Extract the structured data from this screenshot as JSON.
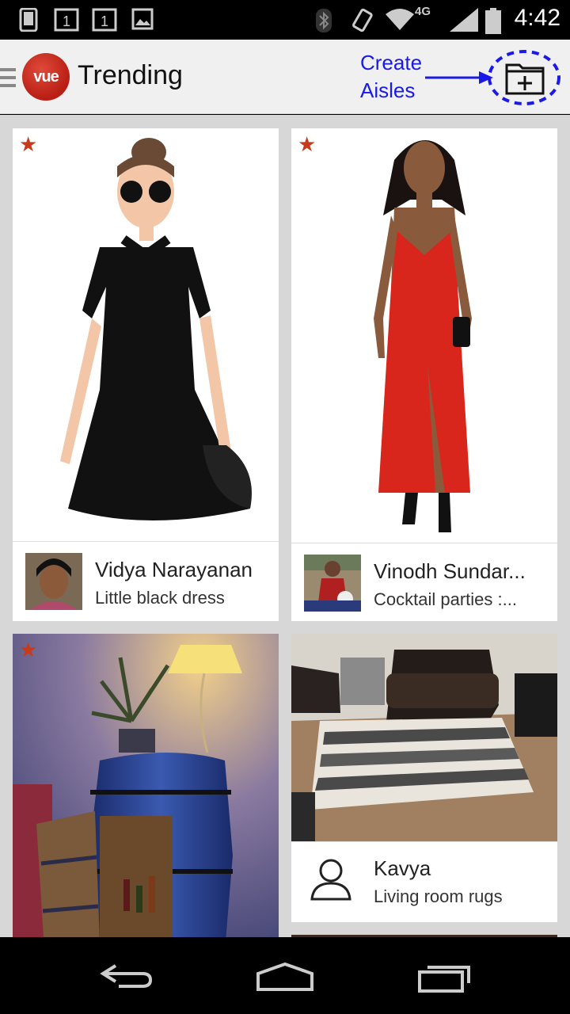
{
  "status_bar": {
    "time": "4:42",
    "network": "4G",
    "icons": [
      "phone-icon",
      "sim1-icon",
      "sim1-icon",
      "image-icon",
      "bluetooth-icon",
      "vibrate-icon",
      "wifi-icon",
      "signal-icon",
      "battery-icon"
    ]
  },
  "action_bar": {
    "logo_text": "vue",
    "title": "Trending",
    "annotation_line1": "Create",
    "annotation_line2": "Aisles",
    "add_icon": "folder-plus-icon",
    "annotation_color": "#1a1ae6"
  },
  "cards": [
    {
      "user": "Vidya Narayanan",
      "aisle": "Little black dress",
      "starred": true
    },
    {
      "user": "Vinodh Sundar...",
      "aisle": "Cocktail parties :...",
      "starred": true
    },
    {
      "user": "",
      "aisle": "",
      "starred": true
    },
    {
      "user": "Kavya",
      "aisle": "Living room rugs",
      "starred": false
    }
  ],
  "nav_bar": {
    "icons": [
      "back-icon",
      "home-icon",
      "recents-icon"
    ]
  },
  "colors": {
    "accent": "#c73a1c",
    "background": "#d7d7d7"
  }
}
